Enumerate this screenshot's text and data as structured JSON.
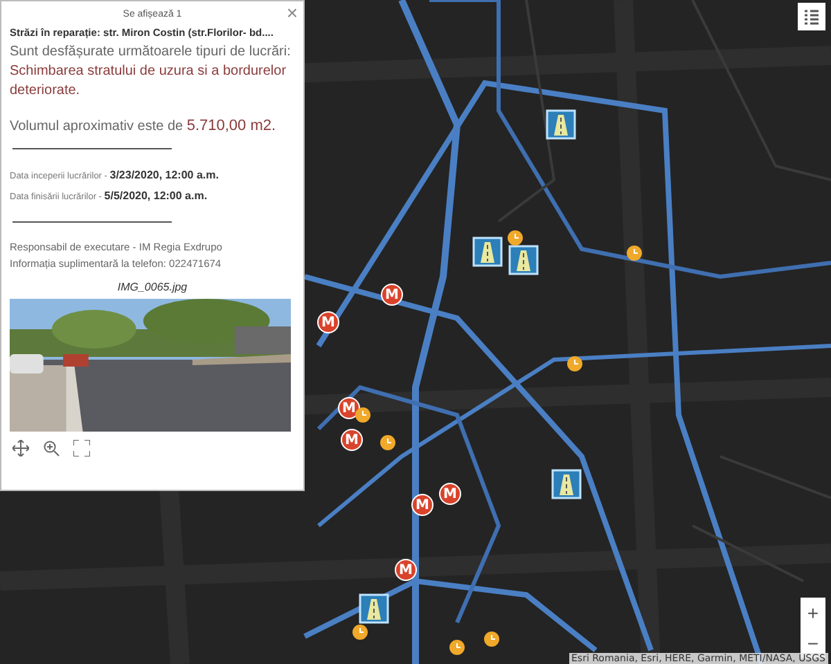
{
  "popup": {
    "header": "Se afișează 1",
    "close": "×",
    "title": "Străzi în reparație: str. Miron Costin (str.Florilor- bd....",
    "description": {
      "intro": "Sunt desfășurate următoarele tipuri de lucrări: ",
      "works": "Schimbarea stratului de uzura si a bordurelor deteriorate."
    },
    "volume": {
      "label": "Volumul aproximativ este de ",
      "value": "5.710,00 m2."
    },
    "dates": [
      {
        "label": "Data inceperii lucrărilor - ",
        "value": "3/23/2020, 12:00 a.m."
      },
      {
        "label": "Data finisării lucrărilor - ",
        "value": "5/5/2020, 12:00 a.m."
      }
    ],
    "responsible": "Responsabil de executare  - IM Regia Exdrupo",
    "phone": "Informația suplimentară la telefon: 022471674",
    "image_caption": "IMG_0065.jpg"
  },
  "markers": [
    {
      "kind": "metro",
      "label": "M"
    },
    {
      "kind": "metro",
      "label": "M"
    },
    {
      "kind": "metro",
      "label": "M"
    },
    {
      "kind": "metro",
      "label": "M"
    },
    {
      "kind": "metro",
      "label": "M"
    },
    {
      "kind": "metro",
      "label": "M"
    },
    {
      "kind": "metro",
      "label": "M"
    },
    {
      "kind": "roadwork"
    },
    {
      "kind": "roadwork"
    },
    {
      "kind": "roadwork"
    },
    {
      "kind": "roadwork"
    },
    {
      "kind": "roadwork"
    },
    {
      "kind": "clock"
    },
    {
      "kind": "clock"
    },
    {
      "kind": "clock"
    },
    {
      "kind": "clock"
    },
    {
      "kind": "clock"
    },
    {
      "kind": "clock"
    },
    {
      "kind": "clock"
    },
    {
      "kind": "clock"
    }
  ],
  "zoom": {
    "plus": "+",
    "minus": "−"
  },
  "attribution": "Esri Romania, Esri, HERE, Garmin, METI/NASA, USGS"
}
